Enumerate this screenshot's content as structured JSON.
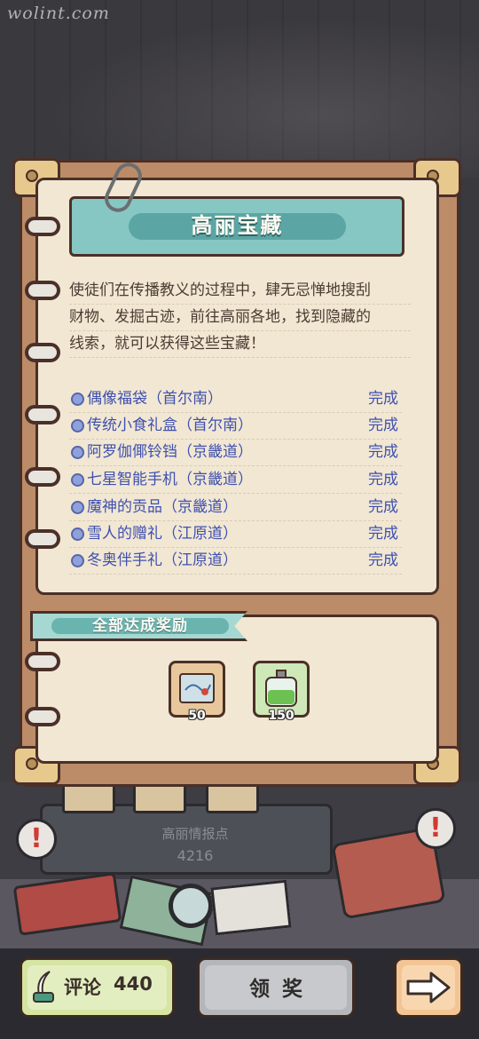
{
  "watermark": "wolint.com",
  "title": "高丽宝藏",
  "description": [
    "使徒们在传播教义的过程中，肆无忌惮地搜刮",
    "财物、发掘古迹，前往高丽各地，找到隐藏的",
    "线索，就可以获得这些宝藏！"
  ],
  "quests": [
    {
      "name": "偶像福袋（首尔南）",
      "status": "完成"
    },
    {
      "name": "传统小食礼盒（首尔南）",
      "status": "完成"
    },
    {
      "name": "阿罗伽倻铃铛（京畿道）",
      "status": "完成"
    },
    {
      "name": "七星智能手机（京畿道）",
      "status": "完成"
    },
    {
      "name": "魔神的贡品（京畿道）",
      "status": "完成"
    },
    {
      "name": "雪人的赠礼（江原道）",
      "status": "完成"
    },
    {
      "name": "冬奥伴手礼（江原道）",
      "status": "完成"
    }
  ],
  "reward": {
    "title": "全部达成奖励",
    "items": [
      {
        "icon": "treasure-map-icon",
        "qty": "50"
      },
      {
        "icon": "potion-bottle-icon",
        "qty": "150"
      }
    ]
  },
  "site": {
    "name": "高丽情报点",
    "count": "4216"
  },
  "buttons": {
    "review_label": "评论",
    "review_count": "440",
    "claim_label": "领奖",
    "next_icon": "arrow-right-icon"
  },
  "colors": {
    "accent": "#86c7c4",
    "quest_text": "#3f50b0",
    "paper": "#f1e7d3",
    "frame": "#bc8b68"
  }
}
